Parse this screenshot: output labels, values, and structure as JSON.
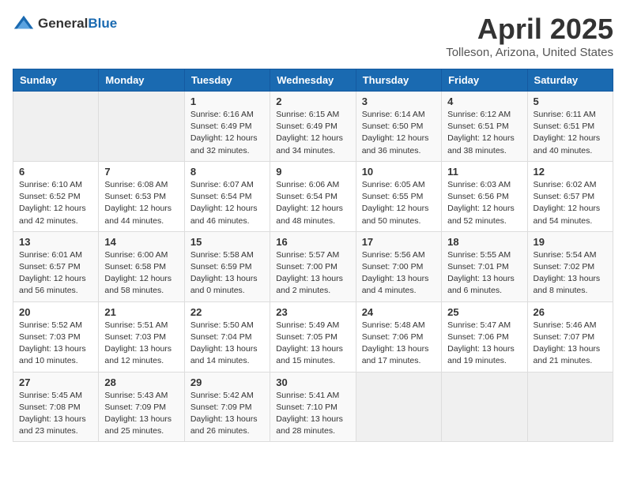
{
  "header": {
    "logo_general": "General",
    "logo_blue": "Blue",
    "month_title": "April 2025",
    "location": "Tolleson, Arizona, United States"
  },
  "weekdays": [
    "Sunday",
    "Monday",
    "Tuesday",
    "Wednesday",
    "Thursday",
    "Friday",
    "Saturday"
  ],
  "weeks": [
    [
      {
        "day": "",
        "info": ""
      },
      {
        "day": "",
        "info": ""
      },
      {
        "day": "1",
        "info": "Sunrise: 6:16 AM\nSunset: 6:49 PM\nDaylight: 12 hours\nand 32 minutes."
      },
      {
        "day": "2",
        "info": "Sunrise: 6:15 AM\nSunset: 6:49 PM\nDaylight: 12 hours\nand 34 minutes."
      },
      {
        "day": "3",
        "info": "Sunrise: 6:14 AM\nSunset: 6:50 PM\nDaylight: 12 hours\nand 36 minutes."
      },
      {
        "day": "4",
        "info": "Sunrise: 6:12 AM\nSunset: 6:51 PM\nDaylight: 12 hours\nand 38 minutes."
      },
      {
        "day": "5",
        "info": "Sunrise: 6:11 AM\nSunset: 6:51 PM\nDaylight: 12 hours\nand 40 minutes."
      }
    ],
    [
      {
        "day": "6",
        "info": "Sunrise: 6:10 AM\nSunset: 6:52 PM\nDaylight: 12 hours\nand 42 minutes."
      },
      {
        "day": "7",
        "info": "Sunrise: 6:08 AM\nSunset: 6:53 PM\nDaylight: 12 hours\nand 44 minutes."
      },
      {
        "day": "8",
        "info": "Sunrise: 6:07 AM\nSunset: 6:54 PM\nDaylight: 12 hours\nand 46 minutes."
      },
      {
        "day": "9",
        "info": "Sunrise: 6:06 AM\nSunset: 6:54 PM\nDaylight: 12 hours\nand 48 minutes."
      },
      {
        "day": "10",
        "info": "Sunrise: 6:05 AM\nSunset: 6:55 PM\nDaylight: 12 hours\nand 50 minutes."
      },
      {
        "day": "11",
        "info": "Sunrise: 6:03 AM\nSunset: 6:56 PM\nDaylight: 12 hours\nand 52 minutes."
      },
      {
        "day": "12",
        "info": "Sunrise: 6:02 AM\nSunset: 6:57 PM\nDaylight: 12 hours\nand 54 minutes."
      }
    ],
    [
      {
        "day": "13",
        "info": "Sunrise: 6:01 AM\nSunset: 6:57 PM\nDaylight: 12 hours\nand 56 minutes."
      },
      {
        "day": "14",
        "info": "Sunrise: 6:00 AM\nSunset: 6:58 PM\nDaylight: 12 hours\nand 58 minutes."
      },
      {
        "day": "15",
        "info": "Sunrise: 5:58 AM\nSunset: 6:59 PM\nDaylight: 13 hours\nand 0 minutes."
      },
      {
        "day": "16",
        "info": "Sunrise: 5:57 AM\nSunset: 7:00 PM\nDaylight: 13 hours\nand 2 minutes."
      },
      {
        "day": "17",
        "info": "Sunrise: 5:56 AM\nSunset: 7:00 PM\nDaylight: 13 hours\nand 4 minutes."
      },
      {
        "day": "18",
        "info": "Sunrise: 5:55 AM\nSunset: 7:01 PM\nDaylight: 13 hours\nand 6 minutes."
      },
      {
        "day": "19",
        "info": "Sunrise: 5:54 AM\nSunset: 7:02 PM\nDaylight: 13 hours\nand 8 minutes."
      }
    ],
    [
      {
        "day": "20",
        "info": "Sunrise: 5:52 AM\nSunset: 7:03 PM\nDaylight: 13 hours\nand 10 minutes."
      },
      {
        "day": "21",
        "info": "Sunrise: 5:51 AM\nSunset: 7:03 PM\nDaylight: 13 hours\nand 12 minutes."
      },
      {
        "day": "22",
        "info": "Sunrise: 5:50 AM\nSunset: 7:04 PM\nDaylight: 13 hours\nand 14 minutes."
      },
      {
        "day": "23",
        "info": "Sunrise: 5:49 AM\nSunset: 7:05 PM\nDaylight: 13 hours\nand 15 minutes."
      },
      {
        "day": "24",
        "info": "Sunrise: 5:48 AM\nSunset: 7:06 PM\nDaylight: 13 hours\nand 17 minutes."
      },
      {
        "day": "25",
        "info": "Sunrise: 5:47 AM\nSunset: 7:06 PM\nDaylight: 13 hours\nand 19 minutes."
      },
      {
        "day": "26",
        "info": "Sunrise: 5:46 AM\nSunset: 7:07 PM\nDaylight: 13 hours\nand 21 minutes."
      }
    ],
    [
      {
        "day": "27",
        "info": "Sunrise: 5:45 AM\nSunset: 7:08 PM\nDaylight: 13 hours\nand 23 minutes."
      },
      {
        "day": "28",
        "info": "Sunrise: 5:43 AM\nSunset: 7:09 PM\nDaylight: 13 hours\nand 25 minutes."
      },
      {
        "day": "29",
        "info": "Sunrise: 5:42 AM\nSunset: 7:09 PM\nDaylight: 13 hours\nand 26 minutes."
      },
      {
        "day": "30",
        "info": "Sunrise: 5:41 AM\nSunset: 7:10 PM\nDaylight: 13 hours\nand 28 minutes."
      },
      {
        "day": "",
        "info": ""
      },
      {
        "day": "",
        "info": ""
      },
      {
        "day": "",
        "info": ""
      }
    ]
  ]
}
